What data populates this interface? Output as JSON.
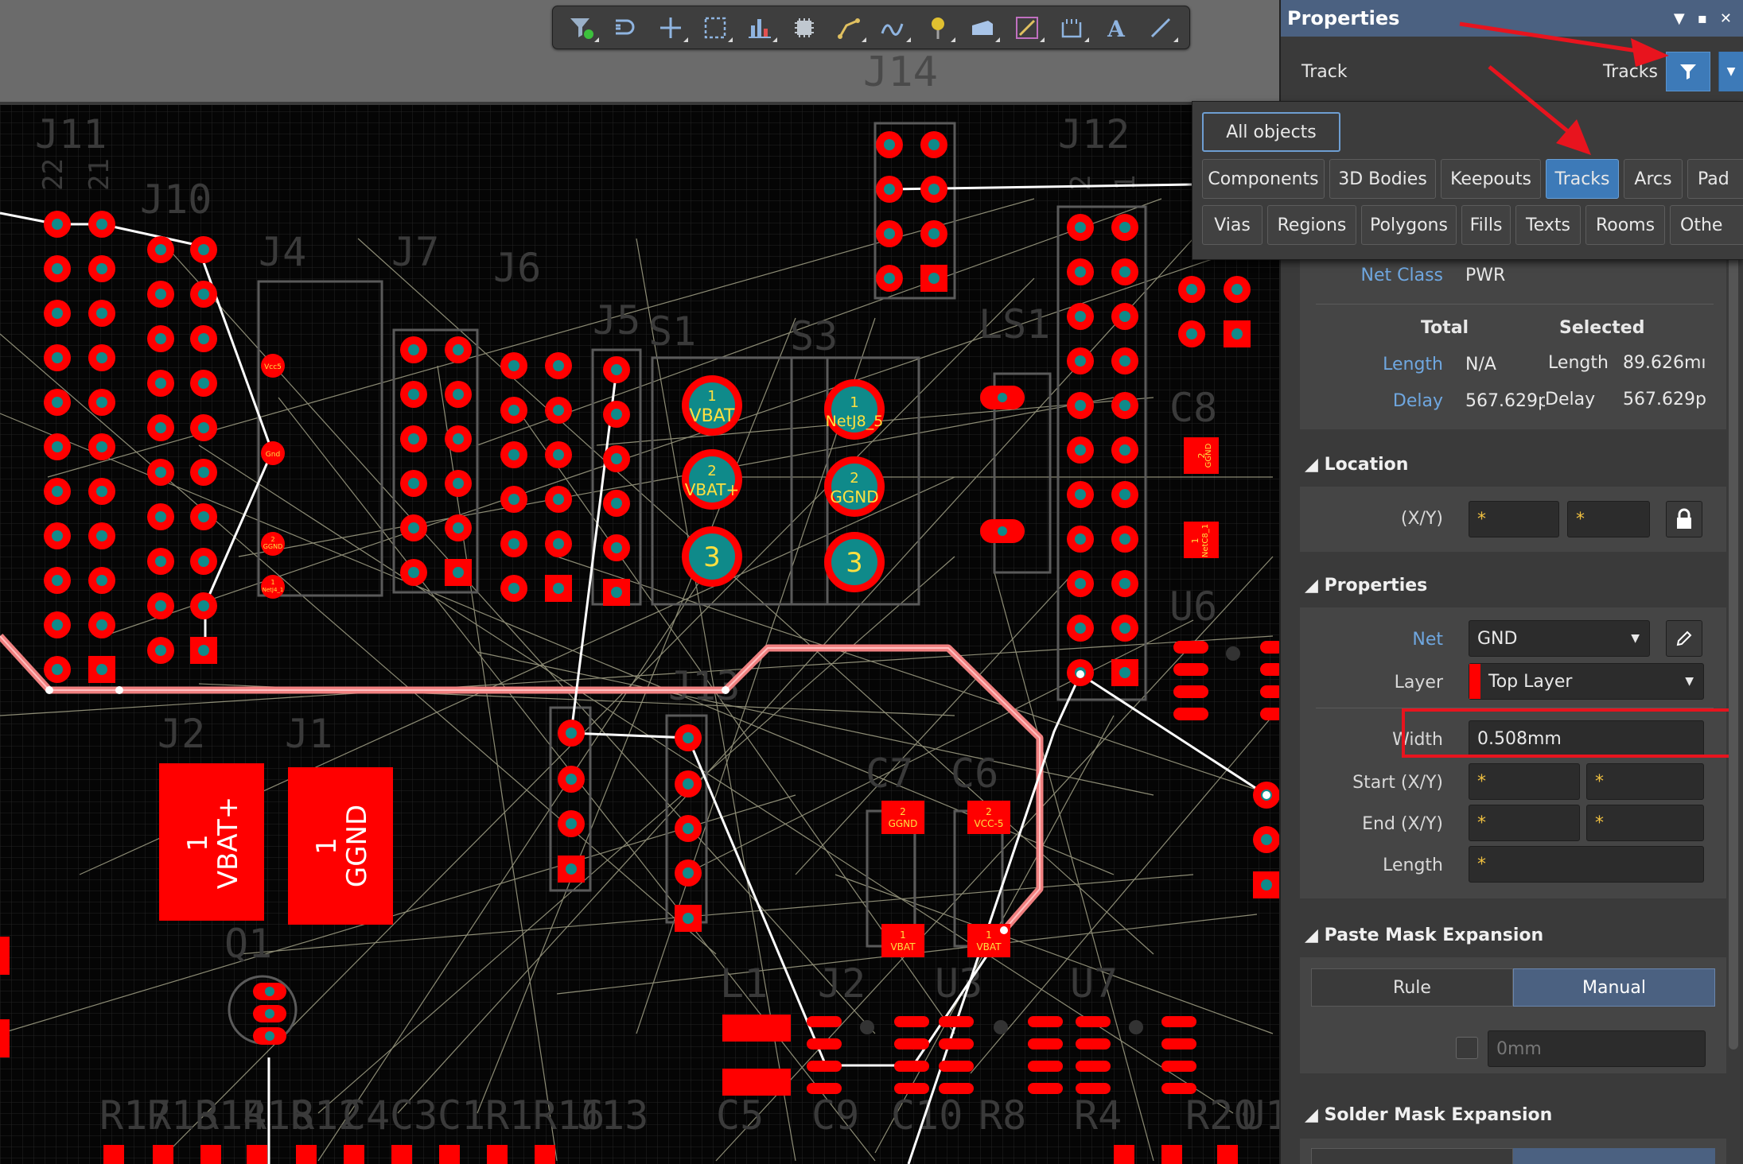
{
  "canvas": {
    "board_title": "J14",
    "designators": [
      "J11",
      "J10",
      "J4",
      "J7",
      "J6",
      "J5",
      "S1",
      "S3",
      "LS1",
      "J12",
      "C8",
      "U6",
      "J2",
      "J1",
      "C7",
      "C6",
      "J13",
      "Q1",
      "L1",
      "J2",
      "U3",
      "U7",
      "R17",
      "R13",
      "R14",
      "R18",
      "R12",
      "C4",
      "C3",
      "C1",
      "R1",
      "R16",
      "J13",
      "C5",
      "C9",
      "C10",
      "R8",
      "R4",
      "R20",
      "U1"
    ],
    "pad_labels": {
      "s1_1": "1",
      "s1_1_net": "VBAT",
      "s1_2": "2",
      "s1_2_net": "VBAT+",
      "s1_3": "3",
      "s3_1": "1",
      "s3_1_net": "NetJ8_5",
      "s3_2": "2",
      "s3_2_net": "GGND",
      "s3_3": "3",
      "j2_pad": "1",
      "j2_net": "VBAT+",
      "j1_pad": "1",
      "j1_net": "GGND",
      "c7_top_num": "2",
      "c7_top_net": "GGND",
      "c6_top_num": "2",
      "c6_top_net": "VCC-5",
      "c7_bot_num": "1",
      "c7_bot_net": "VBAT",
      "c6_bot_num": "1",
      "c6_bot_net": "VBAT",
      "c8_top_num": "2",
      "c8_top_net": "GGND",
      "c8_bot_num": "1",
      "c8_bot_net": "NetC8_1",
      "j4_pad_a": "Vcc5",
      "j4_pad_b": "Gnd",
      "j4_pad_c_num": "2",
      "j4_pad_c": "GGND",
      "j4_pad_d_num": "1",
      "j4_pad_d": "NetJ4_1",
      "j11_pins_a": "22",
      "j11_pins_b": "21",
      "j12_pins_a": "2",
      "j12_pins_b": "1"
    }
  },
  "toolbar": {
    "tools": [
      "filter-icon",
      "route-icon",
      "cross-icon",
      "select-rect-icon",
      "chart-icon",
      "chip-icon",
      "interactive-route-icon",
      "diff-pair-icon",
      "pin-icon",
      "polygon-icon",
      "string-icon",
      "component-icon",
      "text-icon",
      "line-icon"
    ]
  },
  "panel": {
    "title": "Properties",
    "object_type": "Track",
    "filter_label": "Tracks",
    "filter_popup": {
      "all": "All objects",
      "row1": [
        "Components",
        "3D Bodies",
        "Keepouts",
        "Tracks",
        "Arcs",
        "Pad"
      ],
      "row2": [
        "Vias",
        "Regions",
        "Polygons",
        "Fills",
        "Texts",
        "Rooms",
        "Othe"
      ],
      "active": "Tracks"
    },
    "net_info": {
      "net_class_label": "Net Class",
      "net_class_value": "PWR",
      "total_header": "Total",
      "selected_header": "Selected",
      "length_label": "Length",
      "length_total": "N/A",
      "length_sel_label": "Length",
      "length_sel": "89.626mı",
      "delay_label": "Delay",
      "delay_total": "567.629p",
      "delay_sel_label": "Delay",
      "delay_sel": "567.629p"
    },
    "location": {
      "header": "Location",
      "xy_label": "(X/Y)",
      "x": "*",
      "y": "*"
    },
    "properties": {
      "header": "Properties",
      "net_label": "Net",
      "net_value": "GND",
      "layer_label": "Layer",
      "layer_value": "Top Layer",
      "layer_color": "#ff0000",
      "width_label": "Width",
      "width_value": "0.508mm",
      "start_label": "Start (X/Y)",
      "start_x": "*",
      "start_y": "*",
      "end_label": "End (X/Y)",
      "end_x": "*",
      "end_y": "*",
      "length_label": "Length",
      "length_value": "*"
    },
    "paste_mask": {
      "header": "Paste Mask Expansion",
      "rule": "Rule",
      "manual": "Manual",
      "value": "0mm"
    },
    "solder_mask": {
      "header": "Solder Mask Expansion"
    }
  },
  "colors": {
    "pad_red": "#ff0000",
    "pad_teal": "#0f8a8a",
    "track_selected": "#f08080",
    "highlight_box": "#e8141e",
    "accent_blue": "#3d7ab8"
  }
}
